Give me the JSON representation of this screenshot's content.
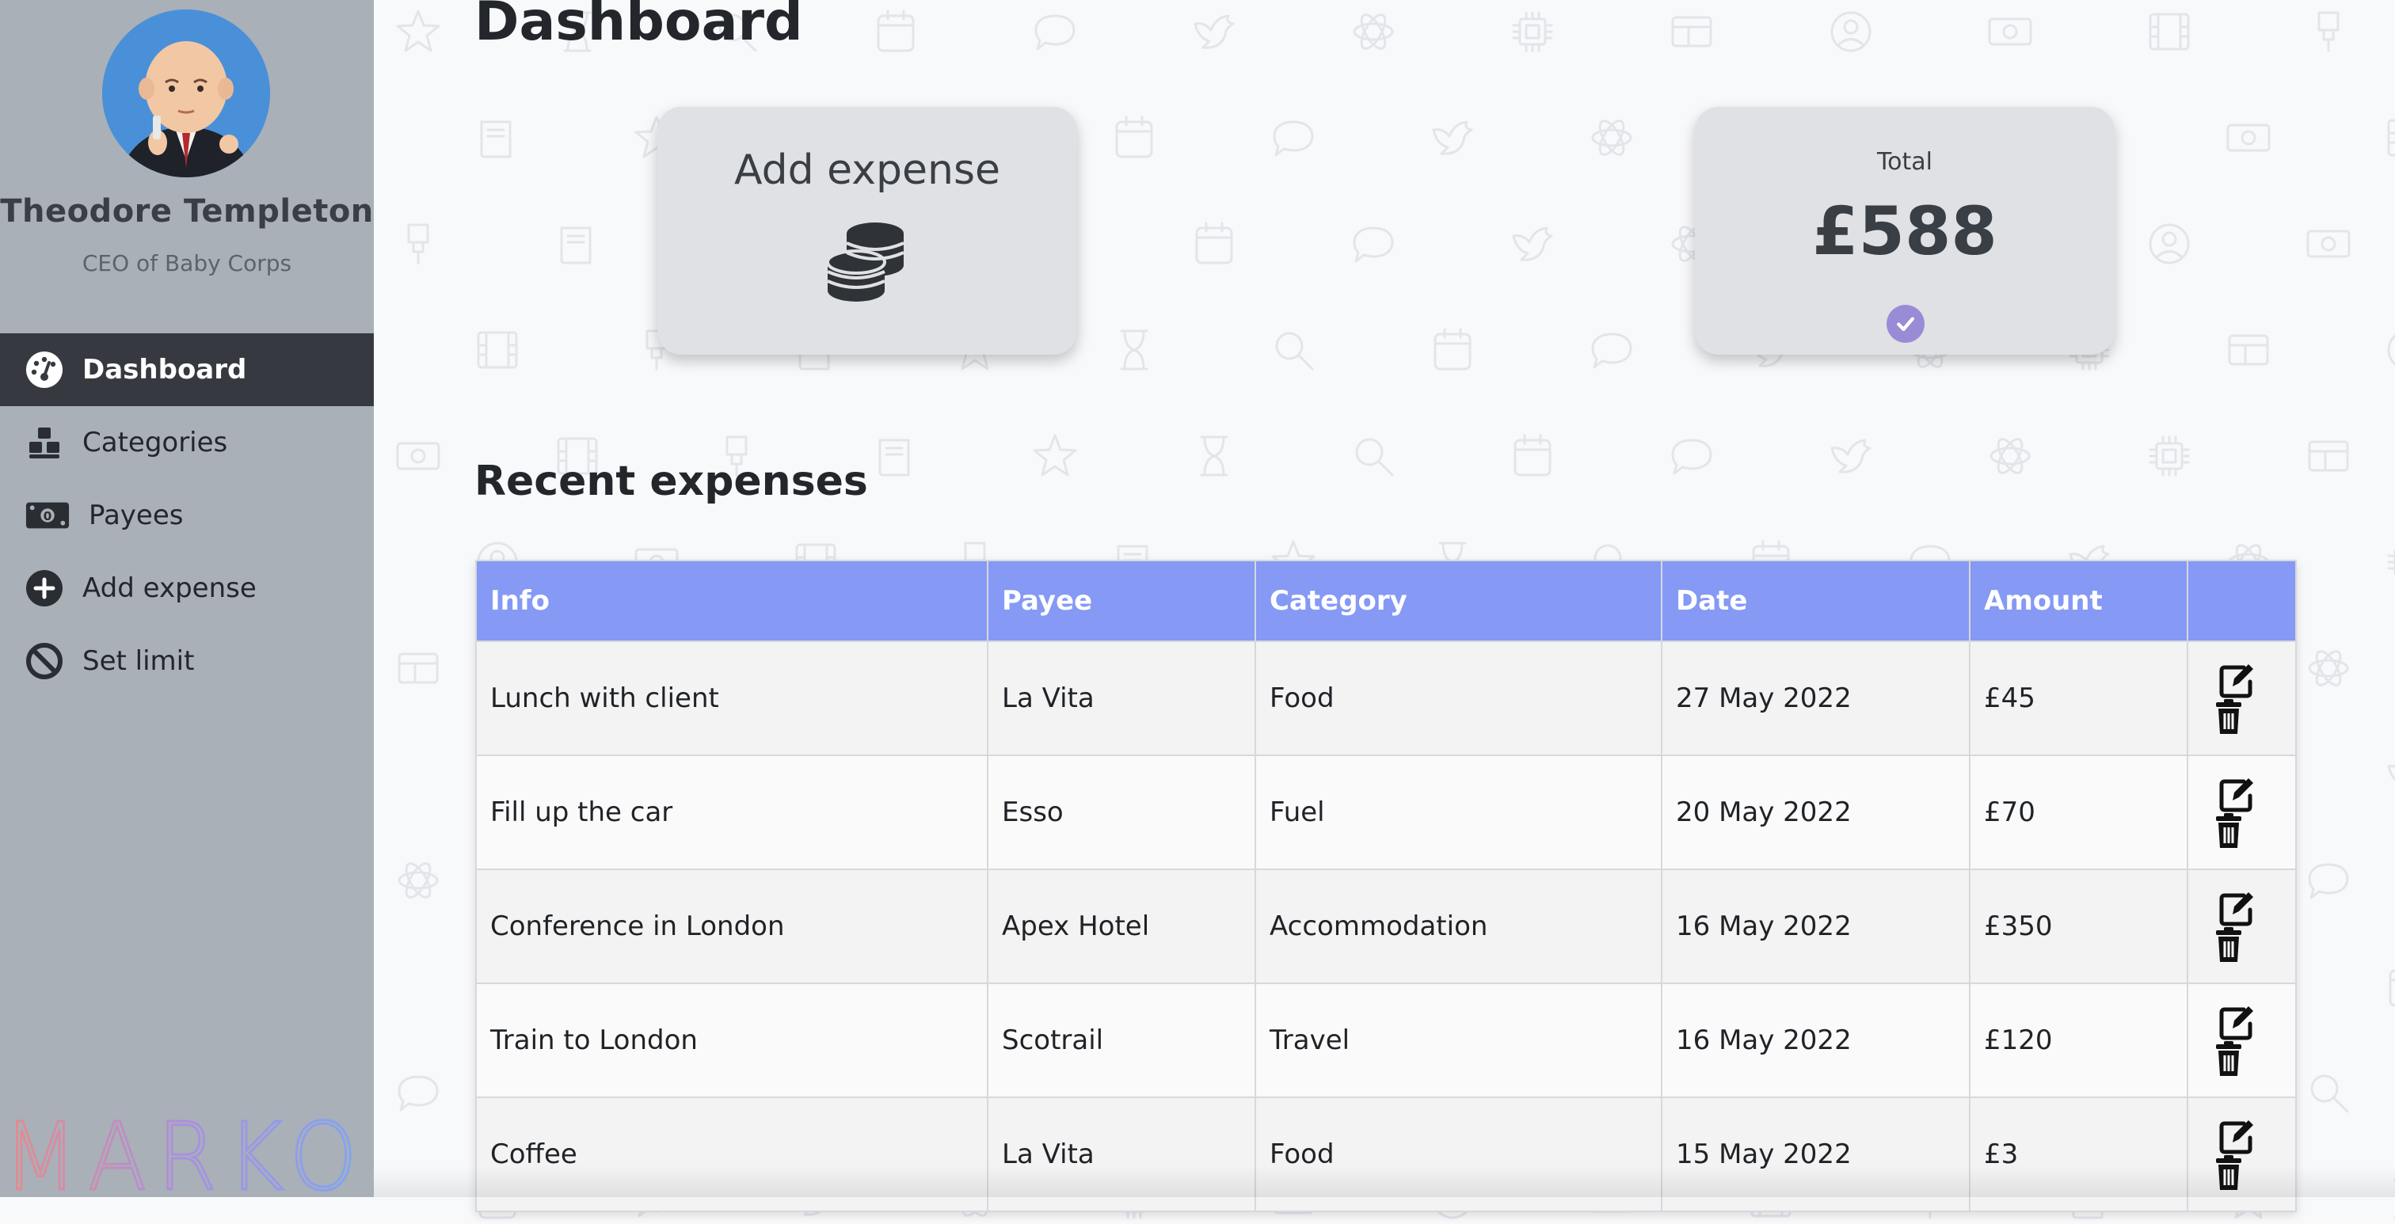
{
  "sidebar": {
    "user_name": "Theodore Templeton",
    "user_role": "CEO of Baby Corps",
    "nav": [
      {
        "label": "Dashboard",
        "icon": "tachometer-icon",
        "active": true
      },
      {
        "label": "Categories",
        "icon": "cubes-icon",
        "active": false
      },
      {
        "label": "Payees",
        "icon": "money-bill-icon",
        "active": false
      },
      {
        "label": "Add expense",
        "icon": "plus-circle-icon",
        "active": false
      },
      {
        "label": "Set limit",
        "icon": "ban-icon",
        "active": false
      }
    ],
    "logo_text": "MARKO"
  },
  "main": {
    "title": "Dashboard",
    "add_card": {
      "title": "Add expense",
      "icon": "coins-icon"
    },
    "total_card": {
      "label": "Total",
      "value": "£588",
      "status_icon": "check-circle-icon"
    },
    "section_title": "Recent expenses",
    "table": {
      "columns": [
        "Info",
        "Payee",
        "Category",
        "Date",
        "Amount",
        ""
      ],
      "rows": [
        {
          "info": "Lunch with client",
          "payee": "La Vita",
          "category": "Food",
          "date": "27 May 2022",
          "amount": "£45"
        },
        {
          "info": "Fill up the car",
          "payee": "Esso",
          "category": "Fuel",
          "date": "20 May 2022",
          "amount": "£70"
        },
        {
          "info": "Conference in London",
          "payee": "Apex Hotel",
          "category": "Accommodation",
          "date": "16 May 2022",
          "amount": "£350"
        },
        {
          "info": "Train to London",
          "payee": "Scotrail",
          "category": "Travel",
          "date": "16 May 2022",
          "amount": "£120"
        },
        {
          "info": "Coffee",
          "payee": "La Vita",
          "category": "Food",
          "date": "15 May 2022",
          "amount": "£3"
        }
      ],
      "row_action_icons": [
        "edit-icon",
        "trash-icon"
      ]
    }
  },
  "colors": {
    "sidebar_bg": "#a9b0b8",
    "nav_active_bg": "#363a40",
    "table_header_bg": "#8599f5",
    "card_bg": "#dfe1e5",
    "check_badge": "#9a8bd6",
    "logo_gradient": [
      "#e98a8a",
      "#a98fe0",
      "#7ea6f2"
    ]
  }
}
